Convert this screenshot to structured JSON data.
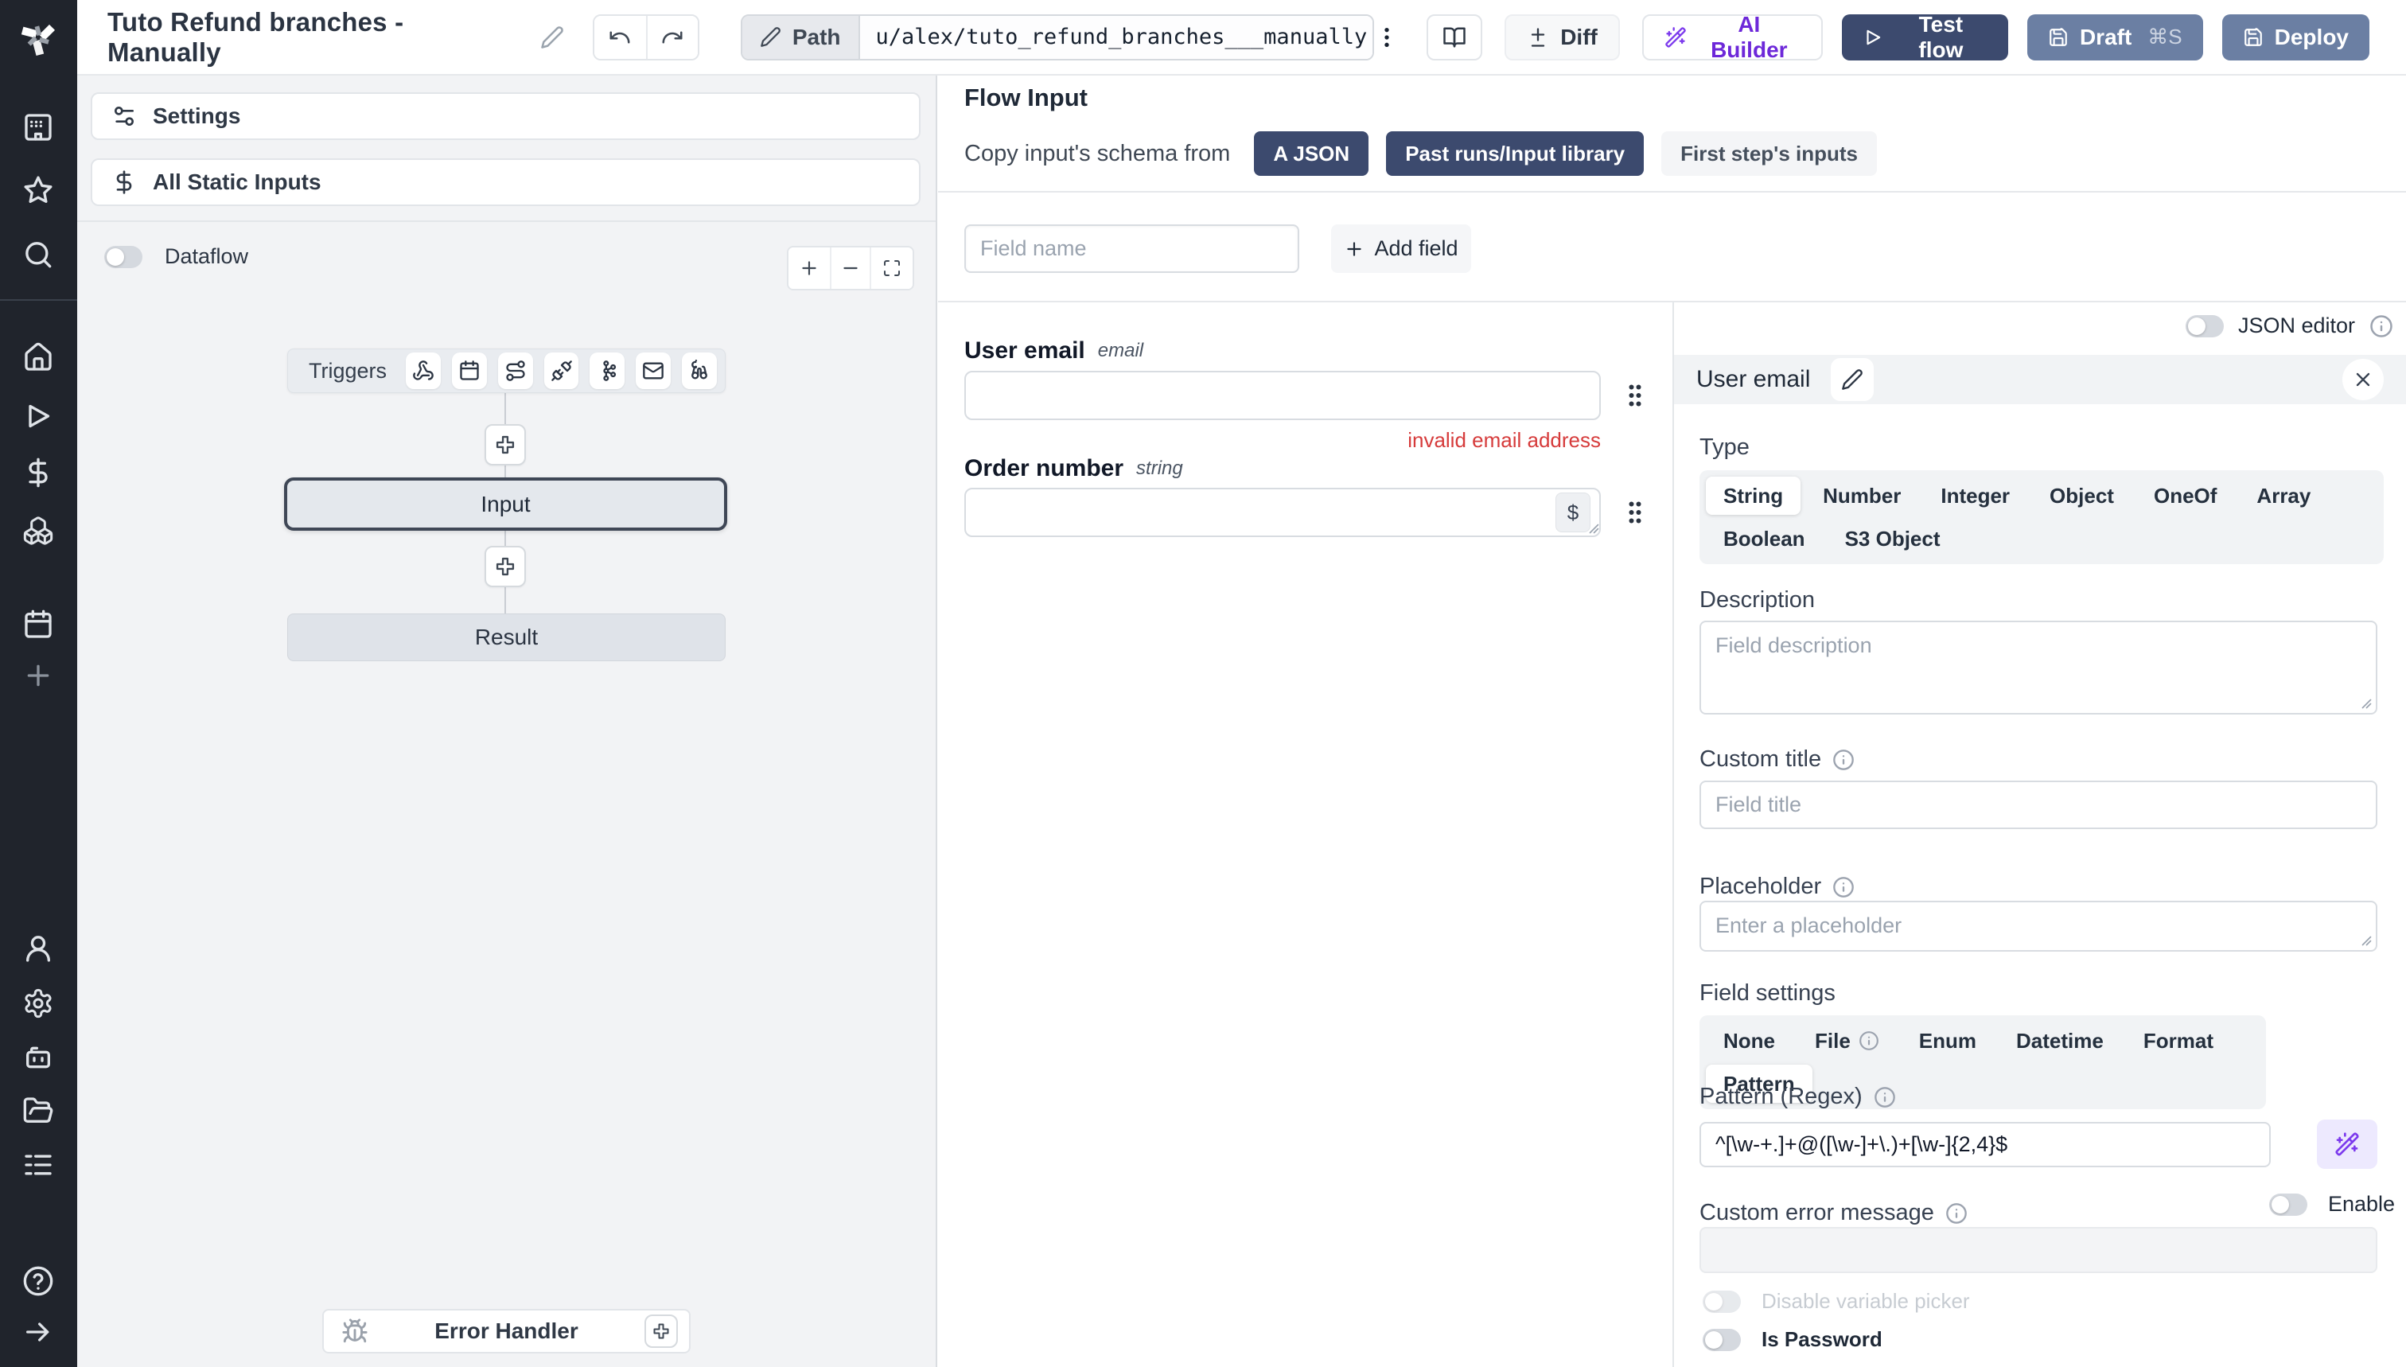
{
  "topbar": {
    "title": "Tuto Refund branches - Manually",
    "path_label": "Path",
    "path_value": "u/alex/tuto_refund_branches___manually",
    "diff_label": "Diff",
    "ai_builder_label": "AI Builder",
    "test_flow_label": "Test flow",
    "draft_label": "Draft",
    "draft_shortcut": "⌘S",
    "deploy_label": "Deploy"
  },
  "rail": {
    "icons": [
      "windmill-logo",
      "apps",
      "star",
      "search",
      "home",
      "runs",
      "variables",
      "resources",
      "schedules",
      "add",
      "user",
      "settings",
      "workers",
      "folders",
      "logs",
      "help",
      "expand"
    ]
  },
  "flow_panel": {
    "settings_label": "Settings",
    "static_inputs_label": "All Static Inputs",
    "dataflow_label": "Dataflow",
    "graph": {
      "triggers_label": "Triggers",
      "trigger_icons": [
        "webhook",
        "schedule",
        "route",
        "websocket",
        "kafka",
        "email",
        "mqtt"
      ],
      "input_label": "Input",
      "result_label": "Result",
      "error_handler_label": "Error Handler"
    }
  },
  "flow_input": {
    "title": "Flow Input",
    "copy_schema_label": "Copy input's schema from",
    "copy_options": [
      "A JSON",
      "Past runs/Input library",
      "First step's inputs"
    ],
    "field_name_placeholder": "Field name",
    "add_field_label": "Add field",
    "fields": [
      {
        "name": "User email",
        "type": "email",
        "error": "invalid email address"
      },
      {
        "name": "Order number",
        "type": "string",
        "badge": "$"
      }
    ]
  },
  "editor": {
    "json_editor_label": "JSON editor",
    "title": "User email",
    "type_label": "Type",
    "types": [
      "String",
      "Number",
      "Integer",
      "Object",
      "OneOf",
      "Array",
      "Boolean",
      "S3 Object"
    ],
    "selected_type": "String",
    "description_label": "Description",
    "description_placeholder": "Field description",
    "custom_title_label": "Custom title",
    "custom_title_placeholder": "Field title",
    "placeholder_label": "Placeholder",
    "placeholder_placeholder": "Enter a placeholder",
    "field_settings_label": "Field settings",
    "field_settings_options": [
      "None",
      "File",
      "Enum",
      "Datetime",
      "Format",
      "Pattern"
    ],
    "selected_setting": "Pattern",
    "pattern_label": "Pattern (Regex)",
    "pattern_value": "^[\\w-+.]+@([\\w-]+\\.)+[\\w-]{2,4}$",
    "custom_error_label": "Custom error message",
    "enable_label": "Enable",
    "disable_variable_picker_label": "Disable variable picker",
    "is_password_label": "Is Password"
  },
  "colors": {
    "primary_navy": "#3c4a6e",
    "secondary_slate": "#6b7fa3",
    "ai_purple": "#6d28d9",
    "error_red": "#d63b3b",
    "panel_gray": "#f2f3f5"
  }
}
